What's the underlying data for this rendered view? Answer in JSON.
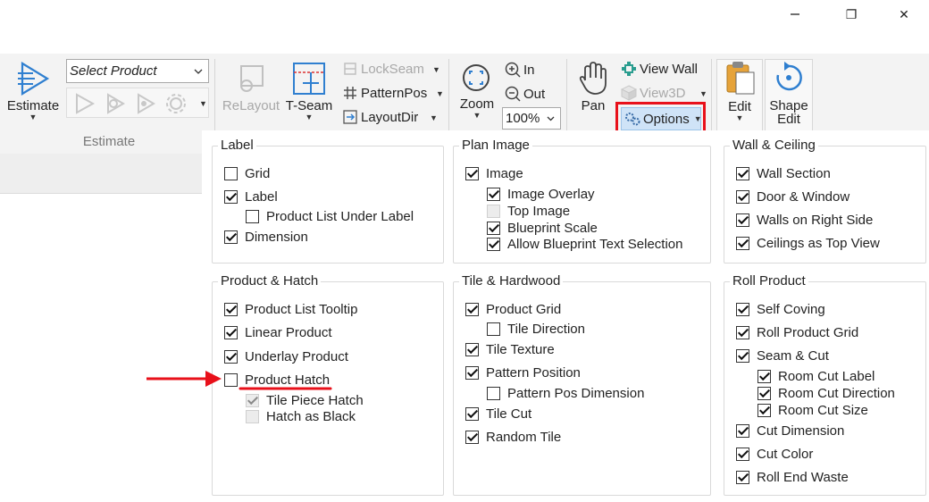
{
  "window": {
    "restore_glyph": "❐",
    "close_glyph": "✕"
  },
  "ribbon": {
    "estimate_label": "Estimate",
    "estimate_group_label": "Estimate",
    "product_select": {
      "value": "Select Product"
    },
    "relayout_label": "ReLayout",
    "tseam_label": "T-Seam",
    "lockseam_label": "LockSeam",
    "patternpos_label": "PatternPos",
    "layoutdir_label": "LayoutDir",
    "zoom_label": "Zoom",
    "zoom_in_label": "In",
    "zoom_out_label": "Out",
    "zoom_level": "100%",
    "pan_label": "Pan",
    "viewwall_label": "View Wall",
    "view3d_label": "View3D",
    "options_label": "Options",
    "edit_label": "Edit",
    "shape_edit_label": "Shape Edit"
  },
  "panel": {
    "label": {
      "title": "Label",
      "items": [
        {
          "text": "Grid",
          "checked": false
        },
        {
          "text": "Label",
          "checked": true
        },
        {
          "text": "Product List Under Label",
          "checked": false
        },
        {
          "text": "Dimension",
          "checked": true
        }
      ]
    },
    "plan_image": {
      "title": "Plan Image",
      "items": [
        {
          "text": "Image",
          "checked": true
        },
        {
          "text": "Image Overlay",
          "checked": true
        },
        {
          "text": "Top Image",
          "checked": false
        },
        {
          "text": "Blueprint Scale",
          "checked": true
        },
        {
          "text": "Allow Blueprint Text Selection",
          "checked": true
        }
      ]
    },
    "wall_ceiling": {
      "title": "Wall & Ceiling",
      "items": [
        {
          "text": "Wall Section",
          "checked": true
        },
        {
          "text": "Door & Window",
          "checked": true
        },
        {
          "text": "Walls on Right Side",
          "checked": true
        },
        {
          "text": "Ceilings as Top View",
          "checked": true
        }
      ]
    },
    "product_hatch": {
      "title": "Product & Hatch",
      "items": [
        {
          "text": "Product List Tooltip",
          "checked": true
        },
        {
          "text": "Linear Product",
          "checked": true
        },
        {
          "text": "Underlay Product",
          "checked": true
        },
        {
          "text": "Product Hatch",
          "checked": false
        },
        {
          "text": "Tile Piece Hatch",
          "checked": true
        },
        {
          "text": "Hatch as Black",
          "checked": false
        }
      ]
    },
    "tile_hardwood": {
      "title": "Tile & Hardwood",
      "items": [
        {
          "text": "Product Grid",
          "checked": true
        },
        {
          "text": "Tile Direction",
          "checked": false
        },
        {
          "text": "Tile Texture",
          "checked": true
        },
        {
          "text": "Pattern Position",
          "checked": true
        },
        {
          "text": "Pattern Pos Dimension",
          "checked": false
        },
        {
          "text": "Tile Cut",
          "checked": true
        },
        {
          "text": "Random Tile",
          "checked": true
        }
      ]
    },
    "roll_product": {
      "title": "Roll Product",
      "items": [
        {
          "text": "Self Coving",
          "checked": true
        },
        {
          "text": "Roll Product Grid",
          "checked": true
        },
        {
          "text": "Seam & Cut",
          "checked": true
        },
        {
          "text": "Room Cut Label",
          "checked": true
        },
        {
          "text": "Room Cut Direction",
          "checked": true
        },
        {
          "text": "Room Cut Size",
          "checked": true
        },
        {
          "text": "Cut Dimension",
          "checked": true
        },
        {
          "text": "Cut Color",
          "checked": true
        },
        {
          "text": "Roll End Waste",
          "checked": true
        }
      ]
    }
  },
  "colors": {
    "highlight_red": "#e8101a",
    "accent_blue": "#2f7fd0",
    "options_bg": "#cfe3f7"
  }
}
